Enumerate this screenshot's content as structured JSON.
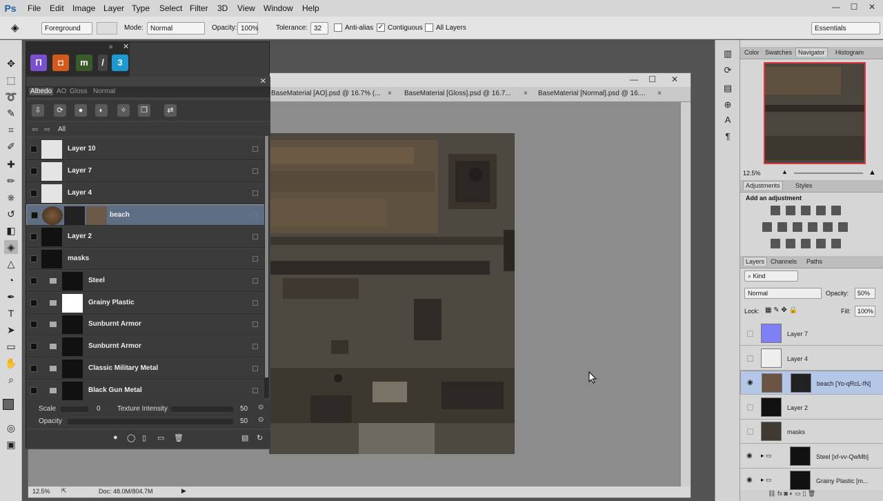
{
  "app": {
    "logo": "Ps"
  },
  "menu": [
    "File",
    "Edit",
    "Image",
    "Layer",
    "Type",
    "Select",
    "Filter",
    "3D",
    "View",
    "Window",
    "Help"
  ],
  "options": {
    "fill_source": "Foreground",
    "mode_label": "Mode:",
    "mode_value": "Normal",
    "opacity_label": "Opacity:",
    "opacity_value": "100%",
    "tolerance_label": "Tolerance:",
    "tolerance_value": "32",
    "antialias_label": "Anti-alias",
    "contiguous_label": "Contiguous",
    "all_layers_label": "All Layers",
    "workspace": "Essentials"
  },
  "document": {
    "tabs": [
      "BaseMaterial [AO].psd @ 16.7% (...",
      "BaseMaterial [Gloss].psd @ 16.7...",
      "BaseMaterial [Normal].psd @ 16...."
    ],
    "zoom": "12.5%",
    "doc_info": "Doc: 48.0M/804.7M"
  },
  "panel": {
    "tabs": [
      "Albedo",
      "AO",
      "Gloss",
      "Normal"
    ],
    "nav_label": "All",
    "layers": [
      {
        "name": "Layer 10"
      },
      {
        "name": "Layer 7"
      },
      {
        "name": "Layer 4"
      },
      {
        "name": "beach"
      },
      {
        "name": "Layer 2"
      },
      {
        "name": "masks"
      },
      {
        "name": "Steel"
      },
      {
        "name": "Grainy Plastic"
      },
      {
        "name": "Sunburnt Armor"
      },
      {
        "name": "Sunburnt Armor"
      },
      {
        "name": "Classic Military Metal"
      },
      {
        "name": "Black Gun Metal"
      }
    ],
    "scale_label": "Scale",
    "scale_value": "0",
    "intensity_label": "Texture Intensity",
    "intensity_value": "50",
    "opacity_label": "Opacity",
    "opacity_value": "50"
  },
  "right": {
    "nav_tabs": [
      "Color",
      "Swatches",
      "Navigator",
      "Histogram"
    ],
    "nav_zoom": "12.5%",
    "adj_tabs": [
      "Adjustments",
      "Styles"
    ],
    "adj_title": "Add an adjustment",
    "layer_tabs": [
      "Layers",
      "Channels",
      "Paths"
    ],
    "kind": "Kind",
    "blend": "Normal",
    "opacity_label": "Opacity:",
    "opacity_value": "50%",
    "lock_label": "Lock:",
    "fill_label": "Fill:",
    "fill_value": "100%",
    "layers": [
      {
        "name": "Layer 7"
      },
      {
        "name": "Layer 4"
      },
      {
        "name": "beach [Yo-qRcL-fN]"
      },
      {
        "name": "Layer 2"
      },
      {
        "name": "masks"
      },
      {
        "name": "Steel [xf-vv-QwMb]"
      },
      {
        "name": "Grainy Plastic [m..."
      }
    ]
  }
}
